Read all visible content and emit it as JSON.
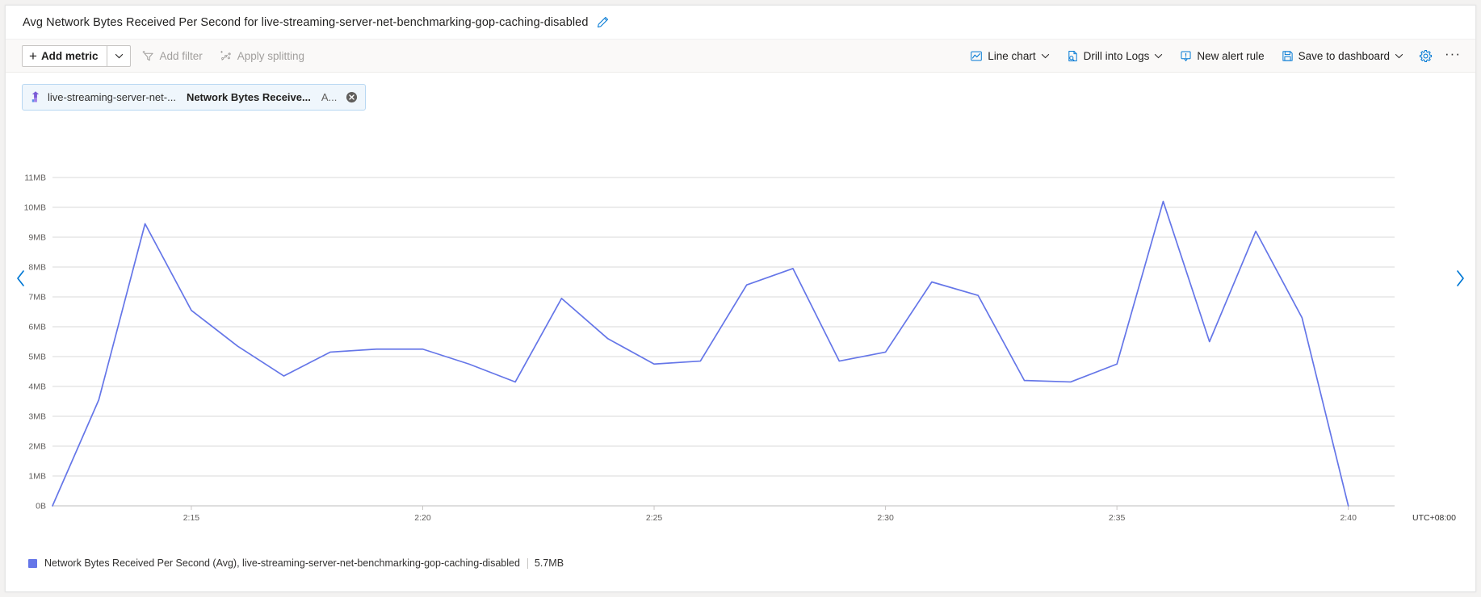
{
  "header": {
    "title": "Avg Network Bytes Received Per Second for live-streaming-server-net-benchmarking-gop-caching-disabled",
    "edit_icon": "pencil-icon"
  },
  "toolbar": {
    "add_metric_label": "Add metric",
    "add_metric_caret": "chevron-down-icon",
    "add_filter_label": "Add filter",
    "apply_splitting_label": "Apply splitting",
    "chart_type_label": "Line chart",
    "drill_logs_label": "Drill into Logs",
    "new_alert_label": "New alert rule",
    "save_dashboard_label": "Save to dashboard",
    "settings_icon": "gear-icon",
    "more_label": "···"
  },
  "metric_chip": {
    "resource": "live-streaming-server-net-...",
    "metric": "Network Bytes Receive...",
    "aggregation": "A...",
    "close_icon": "close-circle-icon",
    "resource_icon": "azure-resource-icon"
  },
  "navigation": {
    "prev_icon": "chevron-left-icon",
    "next_icon": "chevron-right-icon"
  },
  "legend": {
    "series_label": "Network Bytes Received Per Second (Avg), live-streaming-server-net-benchmarking-gop-caching-disabled",
    "value": "5.7MB",
    "swatch_color": "#6576e8"
  },
  "chart_data": {
    "type": "line",
    "title": "Avg Network Bytes Received Per Second for live-streaming-server-net-benchmarking-gop-caching-disabled",
    "xlabel": "",
    "ylabel": "",
    "timezone": "UTC+08:00",
    "grid": true,
    "legend_position": "bottom-left",
    "series_color": "#6576e8",
    "ylim": [
      0,
      11
    ],
    "yunit": "MB",
    "yticks": [
      0,
      1,
      2,
      3,
      4,
      5,
      6,
      7,
      8,
      9,
      10,
      11
    ],
    "ytick_labels": [
      "0B",
      "1MB",
      "2MB",
      "3MB",
      "4MB",
      "5MB",
      "6MB",
      "7MB",
      "8MB",
      "9MB",
      "10MB",
      "11MB"
    ],
    "xtick_labels": [
      "2:15",
      "2:20",
      "2:25",
      "2:30",
      "2:35",
      "2:40"
    ],
    "xtick_minutes": [
      135,
      140,
      145,
      150,
      155,
      160
    ],
    "xlim_minutes": [
      132,
      161
    ],
    "series": [
      {
        "name": "Network Bytes Received Per Second (Avg), live-streaming-server-net-benchmarking-gop-caching-disabled",
        "x_minutes": [
          132,
          133,
          134,
          135,
          136,
          137,
          138,
          139,
          140,
          141,
          142,
          143,
          144,
          145,
          146,
          147,
          148,
          149,
          150,
          151,
          152,
          153,
          154,
          155,
          156,
          157,
          158,
          159,
          160
        ],
        "x_labels": [
          "2:12",
          "2:13",
          "2:14",
          "2:15",
          "2:16",
          "2:17",
          "2:18",
          "2:19",
          "2:20",
          "2:21",
          "2:22",
          "2:23",
          "2:24",
          "2:25",
          "2:26",
          "2:27",
          "2:28",
          "2:29",
          "2:30",
          "2:31",
          "2:32",
          "2:33",
          "2:34",
          "2:35",
          "2:36",
          "2:37",
          "2:38",
          "2:39",
          "2:40"
        ],
        "values": [
          0.0,
          3.55,
          9.45,
          6.55,
          5.35,
          4.35,
          5.15,
          5.25,
          5.25,
          4.75,
          4.15,
          6.95,
          5.6,
          4.75,
          4.85,
          7.4,
          7.95,
          4.85,
          5.15,
          7.5,
          7.05,
          4.2,
          4.15,
          4.75,
          10.2,
          5.5,
          9.2,
          6.3,
          0.0
        ]
      }
    ]
  }
}
